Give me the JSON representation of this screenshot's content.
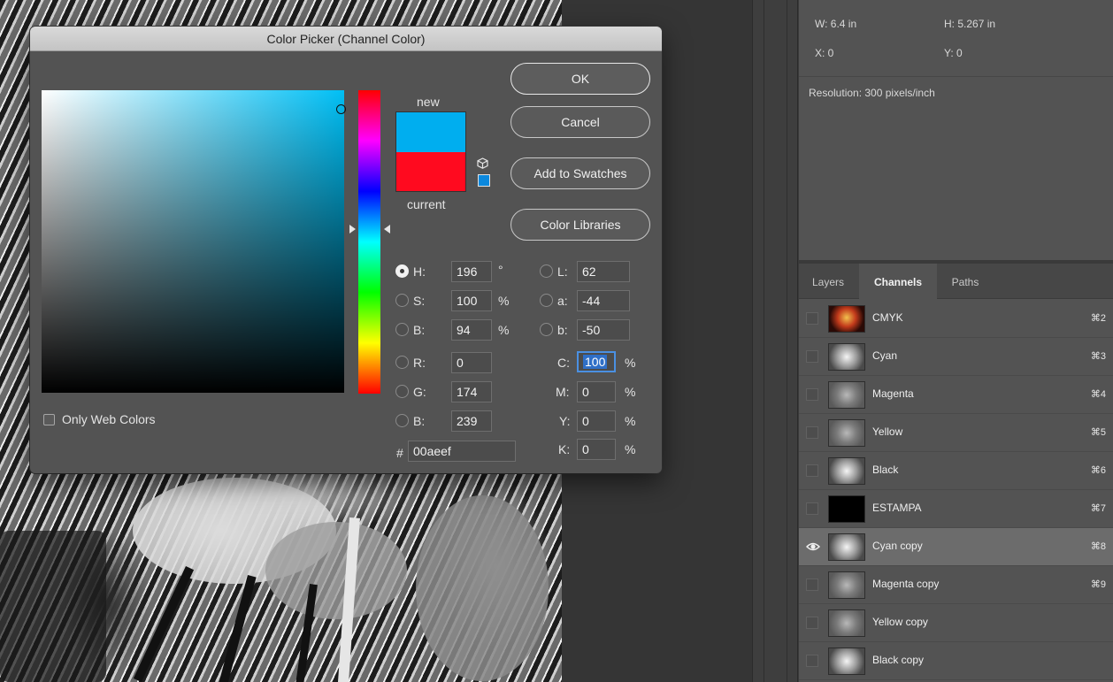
{
  "dialog": {
    "title": "Color Picker (Channel Color)",
    "new_label": "new",
    "current_label": "current",
    "new_color": "#00aeef",
    "current_color": "#ff0a1f",
    "buttons": {
      "ok": "OK",
      "cancel": "Cancel",
      "add_to_swatches": "Add to Swatches",
      "color_libraries": "Color Libraries"
    },
    "only_web_colors": {
      "label": "Only Web Colors",
      "checked": false
    },
    "hsb": {
      "h": {
        "label": "H:",
        "value": "196",
        "unit": "°"
      },
      "s": {
        "label": "S:",
        "value": "100",
        "unit": "%"
      },
      "b": {
        "label": "B:",
        "value": "94",
        "unit": "%"
      }
    },
    "rgb": {
      "r": {
        "label": "R:",
        "value": "0"
      },
      "g": {
        "label": "G:",
        "value": "174"
      },
      "b": {
        "label": "B:",
        "value": "239"
      }
    },
    "lab": {
      "l": {
        "label": "L:",
        "value": "62"
      },
      "a": {
        "label": "a:",
        "value": "-44"
      },
      "b": {
        "label": "b:",
        "value": "-50"
      }
    },
    "cmyk": {
      "c": {
        "label": "C:",
        "value": "100",
        "unit": "%"
      },
      "m": {
        "label": "M:",
        "value": "0",
        "unit": "%"
      },
      "y": {
        "label": "Y:",
        "value": "0",
        "unit": "%"
      },
      "k": {
        "label": "K:",
        "value": "0",
        "unit": "%"
      }
    },
    "hex": {
      "label": "#",
      "value": "00aeef"
    },
    "selected_mode": "H"
  },
  "info": {
    "w": "W: 6.4 in",
    "h": "H: 5.267 in",
    "x": "X: 0",
    "y": "Y: 0",
    "resolution": "Resolution: 300 pixels/inch"
  },
  "panel": {
    "tabs": [
      "Layers",
      "Channels",
      "Paths"
    ],
    "active_tab": "Channels",
    "channels": [
      {
        "name": "CMYK",
        "shortcut": "⌘2",
        "thumb": "color"
      },
      {
        "name": "Cyan",
        "shortcut": "⌘3",
        "thumb": "light"
      },
      {
        "name": "Magenta",
        "shortcut": "⌘4",
        "thumb": "mid"
      },
      {
        "name": "Yellow",
        "shortcut": "⌘5",
        "thumb": "mid"
      },
      {
        "name": "Black",
        "shortcut": "⌘6",
        "thumb": "light"
      },
      {
        "name": "ESTAMPA",
        "shortcut": "⌘7",
        "thumb": "black"
      },
      {
        "name": "Cyan copy",
        "shortcut": "⌘8",
        "thumb": "light",
        "visible": true,
        "selected": true
      },
      {
        "name": "Magenta copy",
        "shortcut": "⌘9",
        "thumb": "mid"
      },
      {
        "name": "Yellow copy",
        "shortcut": "",
        "thumb": "mid"
      },
      {
        "name": "Black copy",
        "shortcut": "",
        "thumb": "light"
      }
    ]
  }
}
